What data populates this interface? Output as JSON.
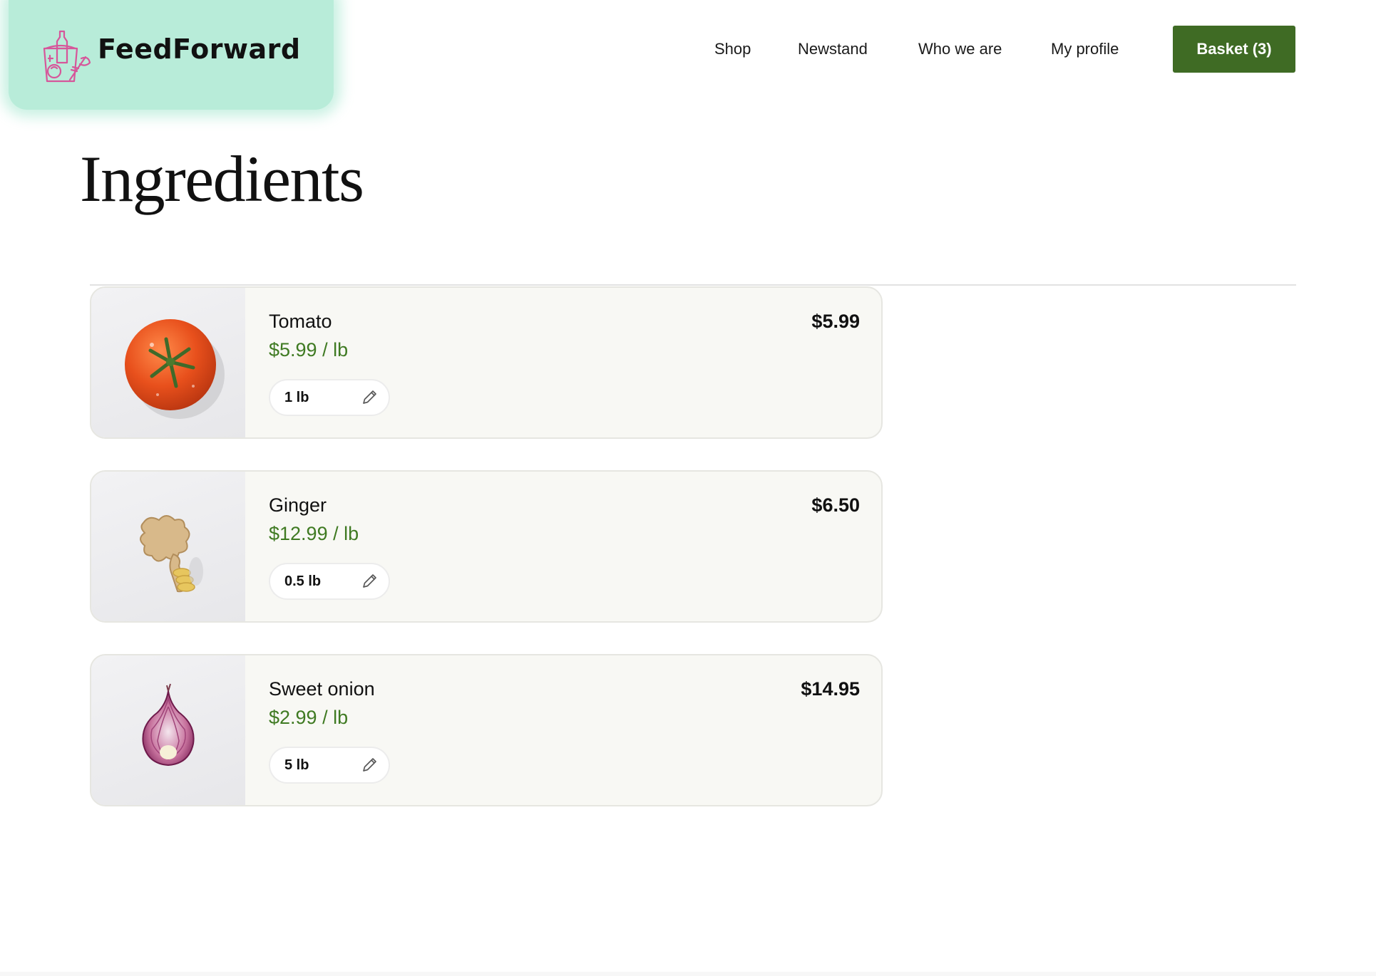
{
  "brand": {
    "name": "FeedForward",
    "logo_icon": "grocery-bag-icon",
    "logo_color": "#d6569a",
    "header_bg": "#b8ecd9"
  },
  "nav": {
    "items": [
      "Shop",
      "Newstand",
      "Who we are",
      "My profile"
    ],
    "basket_label": "Basket (3)",
    "basket_color": "#3f6b24"
  },
  "page": {
    "title": "Ingredients"
  },
  "cart": {
    "accent_green": "#3f7a22",
    "items": [
      {
        "name": "Tomato",
        "unit_price": "$5.99 / lb",
        "quantity": "1 lb",
        "total": "$5.99",
        "image": "tomato-image"
      },
      {
        "name": "Ginger",
        "unit_price": "$12.99 / lb",
        "quantity": "0.5 lb",
        "total": "$6.50",
        "image": "ginger-image"
      },
      {
        "name": "Sweet onion",
        "unit_price": "$2.99 / lb",
        "quantity": "5 lb",
        "total": "$14.95",
        "image": "onion-image"
      }
    ]
  }
}
